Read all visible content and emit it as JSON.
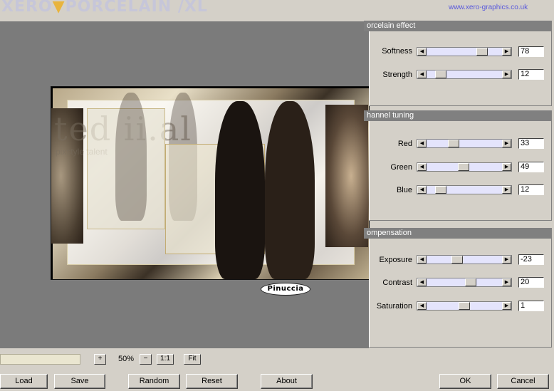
{
  "header": {
    "brand_part1": "XERO",
    "brand_accent": "▼",
    "brand_part2": "PORCELAIN",
    "brand_suffix": " /XL",
    "url": "www.xero-graphics.co.uk"
  },
  "preview": {
    "signature": "Pinuccia",
    "image_text": "ted ii.al",
    "image_subtext": "pixstyle talent"
  },
  "groups": [
    {
      "title": "orcelain effect",
      "params": [
        {
          "label": "Softness",
          "value": "78",
          "level": 0.78
        },
        {
          "label": "Strength",
          "value": "12",
          "level": 0.12
        }
      ]
    },
    {
      "title": "hannel tuning",
      "params": [
        {
          "label": "Red",
          "value": "33",
          "level": 0.33
        },
        {
          "label": "Green",
          "value": "49",
          "level": 0.49
        },
        {
          "label": "Blue",
          "value": "12",
          "level": 0.12
        }
      ]
    },
    {
      "title": "ompensation",
      "params": [
        {
          "label": "Exposure",
          "value": "-23",
          "level": 0.385
        },
        {
          "label": "Contrast",
          "value": "20",
          "level": 0.6
        },
        {
          "label": "Saturation",
          "value": "1",
          "level": 0.505
        }
      ]
    }
  ],
  "zoom": {
    "plus": "+",
    "value": "50%",
    "minus": "−",
    "one_to_one": "1:1",
    "fit": "Fit"
  },
  "buttons": {
    "load": "Load",
    "save": "Save",
    "random": "Random",
    "reset": "Reset",
    "about": "About",
    "ok": "OK",
    "cancel": "Cancel"
  },
  "colors": {
    "panel": "#d4d0c8",
    "group_header": "#808080",
    "slider_track": "#e4e4fc",
    "preview_bg": "#7b7b7b",
    "url": "#5a5adc"
  }
}
